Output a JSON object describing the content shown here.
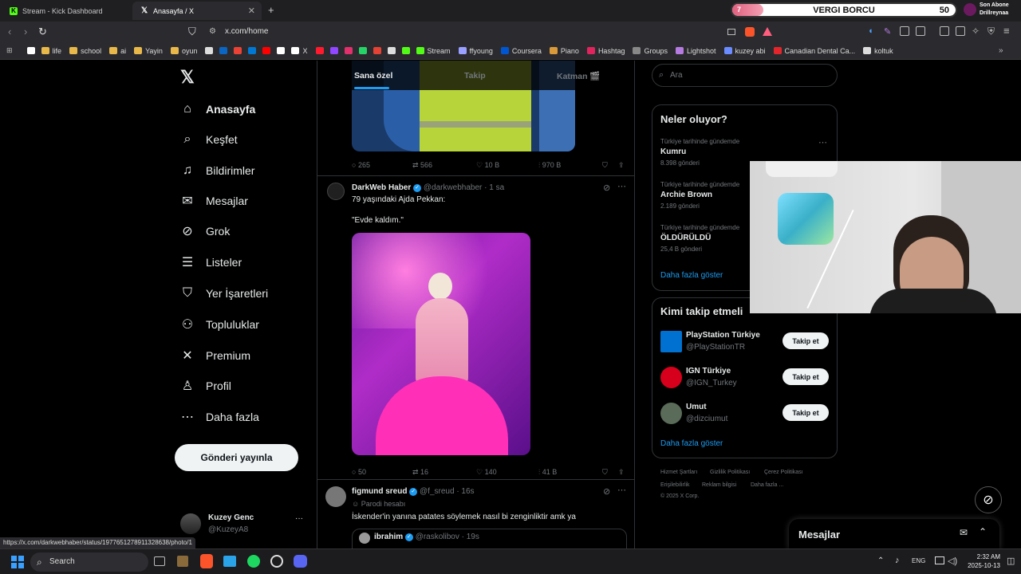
{
  "browser": {
    "tabs": [
      {
        "label": "Stream - Kick Dashboard",
        "icon": "kick-icon"
      },
      {
        "label": "Anasayfa / X",
        "icon": "x-logo-icon"
      }
    ],
    "new_tab": "+",
    "url": "x.com/home",
    "bookmarks": [
      {
        "label": "",
        "icon": "google-icon",
        "color": "#ffffff"
      },
      {
        "label": "life",
        "icon": "folder-icon",
        "color": "#e8b94a"
      },
      {
        "label": "school",
        "icon": "folder-icon",
        "color": "#e8b94a"
      },
      {
        "label": "ai",
        "icon": "folder-icon",
        "color": "#e8b94a"
      },
      {
        "label": "Yayin",
        "icon": "folder-icon",
        "color": "#e8b94a"
      },
      {
        "label": "oyun",
        "icon": "folder-icon",
        "color": "#e8b94a"
      },
      {
        "label": "",
        "icon": "wikipedia-icon",
        "color": "#dddddd"
      },
      {
        "label": "",
        "icon": "linkedin-icon",
        "color": "#0a66c2"
      },
      {
        "label": "",
        "icon": "gmail-icon",
        "color": "#ea4335"
      },
      {
        "label": "",
        "icon": "outlook-icon",
        "color": "#0078d4"
      },
      {
        "label": "",
        "icon": "youtube-icon",
        "color": "#ff0000"
      },
      {
        "label": "",
        "icon": "google-icon",
        "color": "#ffffff"
      },
      {
        "label": "X",
        "icon": "x-logo-icon",
        "color": "#ffffff"
      },
      {
        "label": "",
        "icon": "opera-icon",
        "color": "#ff1b2d"
      },
      {
        "label": "",
        "icon": "twitch-icon",
        "color": "#9146ff"
      },
      {
        "label": "",
        "icon": "instagram-icon",
        "color": "#e1306c"
      },
      {
        "label": "",
        "icon": "whatsapp-icon",
        "color": "#25d366"
      },
      {
        "label": "",
        "icon": "tumblr-icon",
        "color": "#e34234"
      },
      {
        "label": "",
        "icon": "amazon-icon",
        "color": "#dddddd"
      },
      {
        "label": "",
        "icon": "kick-icon",
        "color": "#53fc18"
      },
      {
        "label": "Stream",
        "icon": "kick-icon",
        "color": "#53fc18"
      },
      {
        "label": "ffyoung",
        "icon": "link-icon",
        "color": "#9aa0ff"
      },
      {
        "label": "Coursera",
        "icon": "coursera-icon",
        "color": "#0056d2"
      },
      {
        "label": "Piano",
        "icon": "piano-icon",
        "color": "#d99a3a"
      },
      {
        "label": "Hashtag",
        "icon": "hashtag-icon",
        "color": "#e0245e"
      },
      {
        "label": "Groups",
        "icon": "groups-icon",
        "color": "#888888"
      },
      {
        "label": "Lightshot",
        "icon": "lightshot-icon",
        "color": "#b67be0"
      },
      {
        "label": "kuzey abi",
        "icon": "kuzey-icon",
        "color": "#6a8cff"
      },
      {
        "label": "Canadian Dental Ca...",
        "icon": "maple-icon",
        "color": "#e4262c"
      },
      {
        "label": "koltuk",
        "icon": "koltuk-icon",
        "color": "#dddddd"
      }
    ],
    "status_url": "https://x.com/darkwebhaber/status/1977651278911328638/photo/1"
  },
  "stream_overlay": {
    "badge": "7",
    "title": "VERGI BORCU",
    "count": "50",
    "sub_label": "Son Abone",
    "sub_name": "Drillreynaa",
    "goal_progress": 0.14
  },
  "x": {
    "nav": [
      {
        "label": "Anasayfa",
        "icon": "home-icon",
        "glyph": "⌂"
      },
      {
        "label": "Keşfet",
        "icon": "search-icon",
        "glyph": "⌕"
      },
      {
        "label": "Bildirimler",
        "icon": "bell-icon",
        "glyph": "♫"
      },
      {
        "label": "Mesajlar",
        "icon": "mail-icon",
        "glyph": "✉"
      },
      {
        "label": "Grok",
        "icon": "grok-icon",
        "glyph": "⊘"
      },
      {
        "label": "Listeler",
        "icon": "list-icon",
        "glyph": "☰"
      },
      {
        "label": "Yer İşaretleri",
        "icon": "bookmark-icon",
        "glyph": "⛉"
      },
      {
        "label": "Topluluklar",
        "icon": "communities-icon",
        "glyph": "⚇"
      },
      {
        "label": "Premium",
        "icon": "x-premium-icon",
        "glyph": "✕"
      },
      {
        "label": "Profil",
        "icon": "profile-icon",
        "glyph": "♙"
      },
      {
        "label": "Daha fazla",
        "icon": "more-circle-icon",
        "glyph": "⋯"
      }
    ],
    "post_button": "Gönderi yayınla",
    "account": {
      "name": "Kuzey Genc",
      "handle": "@KuzeyA8",
      "more": "···"
    },
    "feed_tabs": [
      "Sana özel",
      "Takip",
      "Katman 🎬"
    ],
    "prev_post_actions": {
      "replies": "265",
      "reposts": "566",
      "likes": "10 B",
      "views": "970 B"
    },
    "posts": [
      {
        "name": "DarkWeb Haber",
        "handle": "@darkwebhaber",
        "time": "· 1 sa",
        "text1": "79 yaşındaki Ajda Pekkan:",
        "text2": "\"Evde kaldım.\"",
        "replies": "50",
        "reposts": "16",
        "likes": "140",
        "views": "41 B"
      },
      {
        "name": "figmund sreud",
        "handle": "@f_sreud",
        "time": "· 16s",
        "sub": "Parodi hesabı",
        "text1": "İskender'in yanına patates söylemek nasıl bi zenginliktir amk ya",
        "quote_name": "ibrahim",
        "quote_handle": "@raskolibov",
        "quote_time": "· 19s"
      }
    ],
    "search_placeholder": "Ara",
    "trends_title": "Neler oluyor?",
    "trends": [
      {
        "context": "Türkiye tarihinde gündemde",
        "name": "Kumru",
        "count": "8.398 gönderi"
      },
      {
        "context": "Türkiye tarihinde gündemde",
        "name": "Archie Brown",
        "count": "2.189 gönderi"
      },
      {
        "context": "Türkiye tarihinde gündemde",
        "name": "ÖLDÜRÜLDÜ",
        "count": "25,4 B gönderi"
      }
    ],
    "show_more": "Daha fazla göster",
    "who_title": "Kimi takip etmeli",
    "who": [
      {
        "name": "PlayStation Türkiye",
        "handle": "@PlayStationTR",
        "button": "Takip et",
        "avatar_color": "#0070d1"
      },
      {
        "name": "IGN Türkiye",
        "handle": "@IGN_Turkey",
        "button": "Takip et",
        "avatar_color": "#d6001c"
      },
      {
        "name": "Umut",
        "handle": "@dizciumut",
        "button": "Takip et",
        "avatar_color": "#5a6b5a"
      }
    ],
    "footer": [
      "Hizmet Şartları",
      "Gizlilik Politikası",
      "Çerez Politikası",
      "Erişilebilirlik",
      "Reklam bilgisi",
      "Daha fazla ...",
      "© 2025 X Corp."
    ],
    "messages_label": "Mesajlar"
  },
  "taskbar": {
    "search": "Search",
    "lang": "ENG",
    "time": "2:32 AM",
    "date": "2025-10-13"
  }
}
